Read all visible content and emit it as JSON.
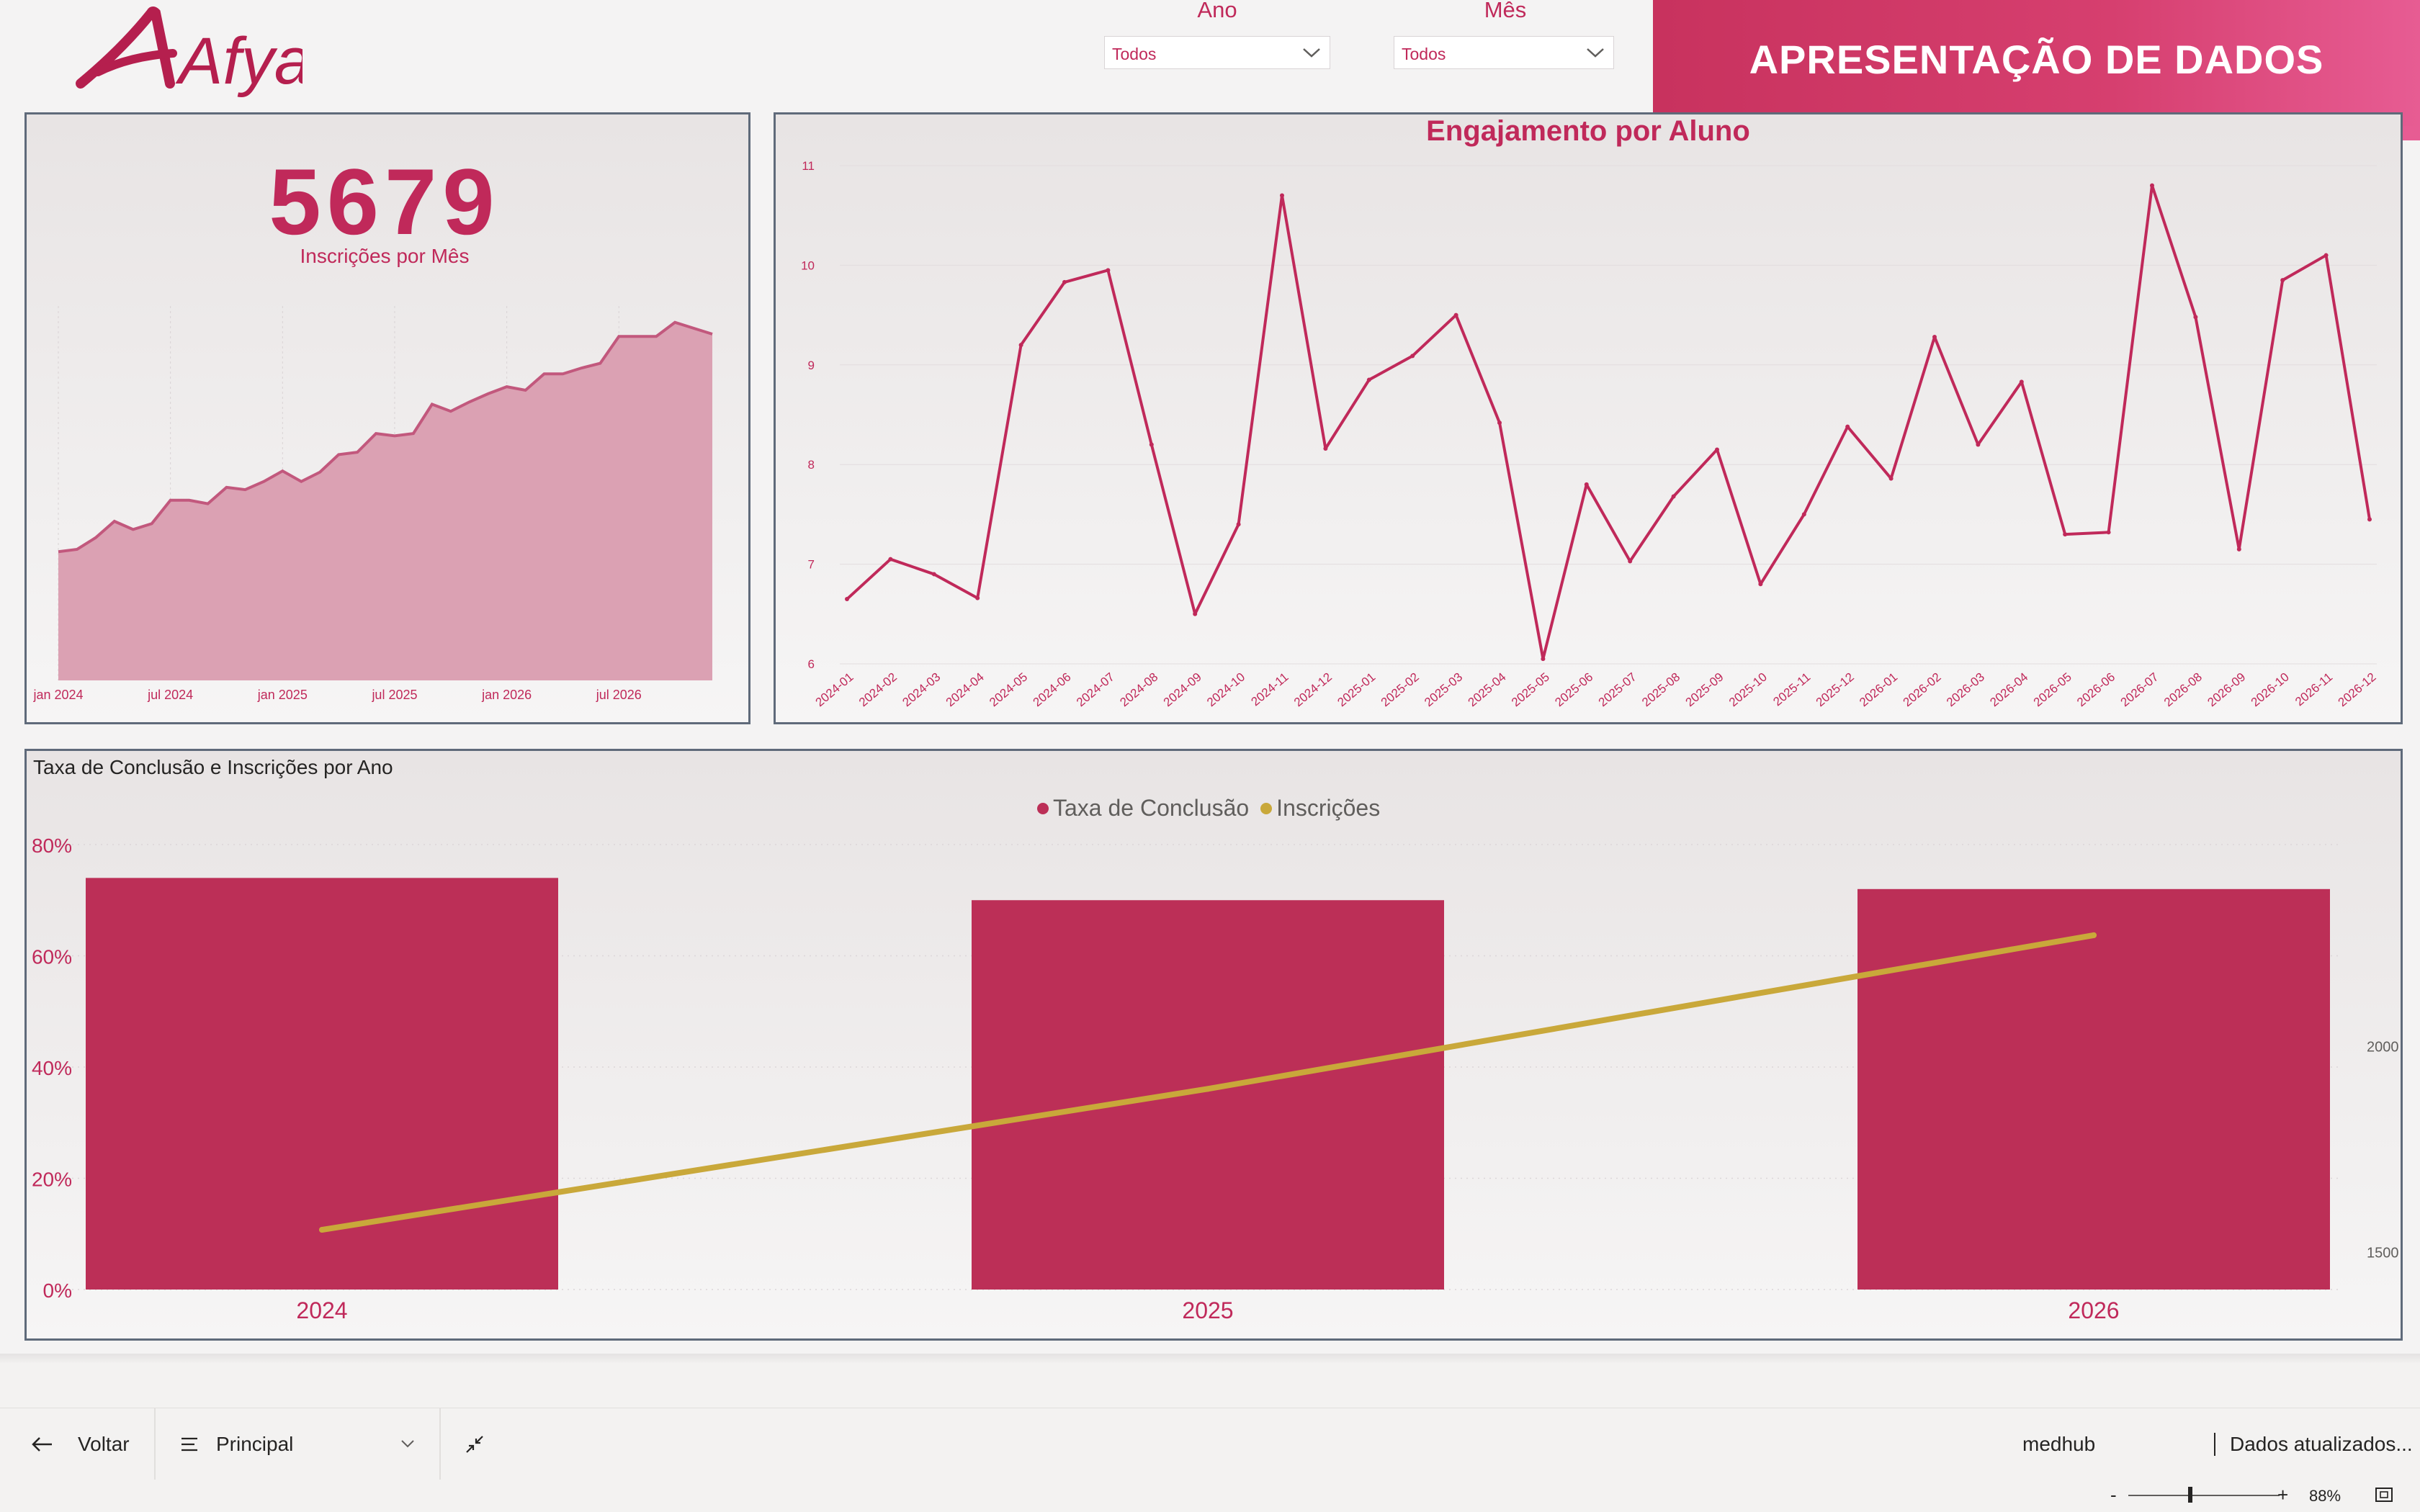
{
  "brand": {
    "logo_text": "Afya",
    "accent": "#c0295a",
    "line_gold": "#c9a83a"
  },
  "filters": {
    "year": {
      "label": "Ano",
      "value": "Todos"
    },
    "month": {
      "label": "Mês",
      "value": "Todos"
    }
  },
  "banner": {
    "title": "APRESENTAÇÃO DE DADOS"
  },
  "kpi": {
    "value": "5679",
    "label": "Inscrições por Mês"
  },
  "area_chart": {
    "type": "area",
    "x_ticks": [
      "jan 2024",
      "jul 2024",
      "jan 2025",
      "jul 2025",
      "jan 2026",
      "jul 2026"
    ],
    "values": [
      110,
      112,
      122,
      136,
      129,
      134,
      154,
      154,
      151,
      165,
      163,
      170,
      179,
      170,
      178,
      193,
      195,
      211,
      209,
      211,
      236,
      230,
      238,
      245,
      251,
      248,
      262,
      262,
      267,
      271,
      294,
      294,
      294,
      306,
      301,
      296
    ]
  },
  "engagement": {
    "title": "Engajamento por Aluno",
    "y_ticks": [
      "6",
      "7",
      "8",
      "9",
      "10",
      "11"
    ],
    "categories": [
      "2024-01",
      "2024-02",
      "2024-03",
      "2024-04",
      "2024-05",
      "2024-06",
      "2024-07",
      "2024-08",
      "2024-09",
      "2024-10",
      "2024-11",
      "2024-12",
      "2025-01",
      "2025-02",
      "2025-03",
      "2025-04",
      "2025-05",
      "2025-06",
      "2025-07",
      "2025-08",
      "2025-09",
      "2025-10",
      "2025-11",
      "2025-12",
      "2026-01",
      "2026-02",
      "2026-03",
      "2026-04",
      "2026-05",
      "2026-06",
      "2026-07",
      "2026-08",
      "2026-09",
      "2026-10",
      "2026-11",
      "2026-12"
    ],
    "values": [
      6.65,
      7.05,
      6.9,
      6.66,
      9.2,
      9.83,
      9.95,
      8.2,
      6.5,
      7.4,
      10.7,
      8.16,
      8.85,
      9.09,
      9.5,
      8.42,
      6.05,
      7.8,
      7.03,
      7.68,
      8.15,
      6.8,
      7.5,
      8.38,
      7.86,
      9.28,
      8.2,
      8.83,
      7.3,
      7.32,
      10.8,
      9.48,
      7.15,
      9.85,
      10.1,
      7.45
    ]
  },
  "chart_data": {
    "type": "bar",
    "title": "Taxa de Conclusão e Inscrições por Ano",
    "categories": [
      "2024",
      "2025",
      "2026"
    ],
    "y_ticks": [
      "0%",
      "20%",
      "40%",
      "60%",
      "80%"
    ],
    "y2_ticks": [
      "1500",
      "2000"
    ],
    "ylim": [
      0,
      80
    ],
    "y2lim": [
      1410,
      2490
    ],
    "series": [
      {
        "name": "Taxa de Conclusão",
        "kind": "bar",
        "axis": "left",
        "color": "#bc2f57",
        "values": [
          74,
          70,
          72
        ]
      },
      {
        "name": "Inscrições",
        "kind": "line",
        "axis": "right",
        "color": "#c9a83a",
        "values": [
          1555,
          1897,
          2270
        ]
      }
    ],
    "legend": "top-center"
  },
  "bottom_bar": {
    "back_label": "Voltar",
    "page_label": "Principal",
    "workspace": "medhub",
    "refresh": "Dados atualizados..."
  },
  "status": {
    "zoom": "88%"
  }
}
